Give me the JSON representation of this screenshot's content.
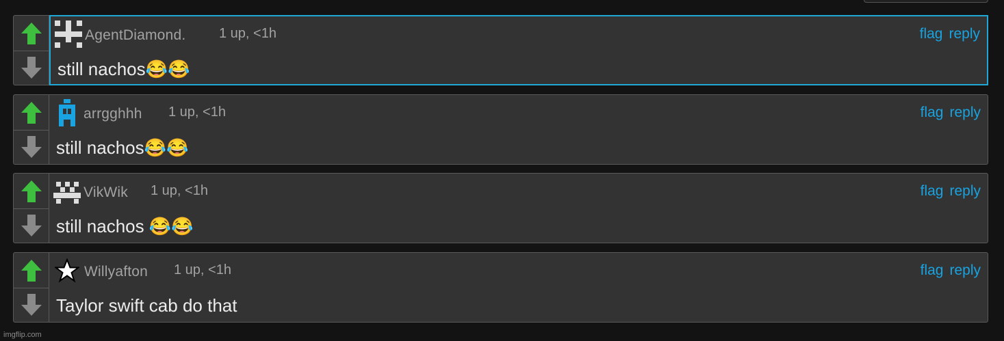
{
  "comments": [
    {
      "username": "AgentDiamond.",
      "meta": "1 up, <1h",
      "text": "still nachos😂😂",
      "flag": "flag",
      "reply": "reply",
      "avatar": "pixel-cross-avatar"
    },
    {
      "username": "arrgghhh",
      "meta": "1 up, <1h",
      "text": "still nachos😂😂",
      "flag": "flag",
      "reply": "reply",
      "avatar": "blue-pixel-avatar"
    },
    {
      "username": "VikWik",
      "meta": "1 up, <1h",
      "text": "still nachos 😂😂",
      "flag": "flag",
      "reply": "reply",
      "avatar": "checker-pixel-avatar"
    },
    {
      "username": "Willyafton",
      "meta": "1 up, <1h",
      "text": "Taylor swift cab do that",
      "flag": "flag",
      "reply": "reply",
      "avatar": "star-avatar"
    }
  ],
  "watermark": "imgflip.com",
  "colors": {
    "upvote": "#3fbf3f",
    "downvote": "#8a8a8a",
    "link": "#19a3e0",
    "highlight": "#1fa7d6"
  }
}
